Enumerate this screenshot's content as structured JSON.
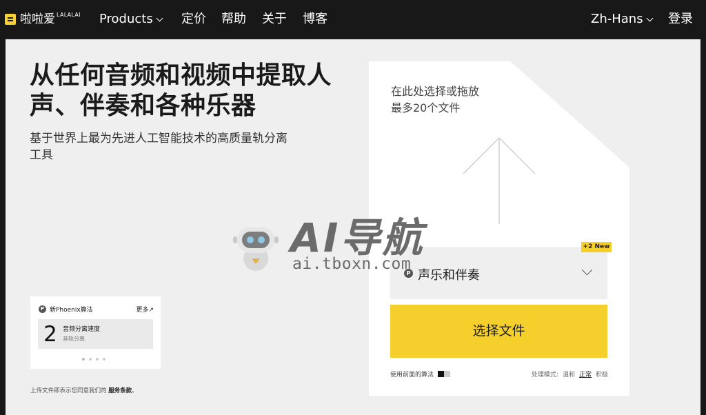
{
  "nav": {
    "logo_text": "啦啦爱",
    "logo_sup": "LALALAI",
    "items": [
      {
        "label": "Products"
      },
      {
        "label": "定价"
      },
      {
        "label": "帮助"
      },
      {
        "label": "关于"
      },
      {
        "label": "博客"
      }
    ],
    "language": "Zh-Hans",
    "login": "登录"
  },
  "hero": {
    "headline": "从任何音频和视频中提取人声、伴奏和各种乐器",
    "subtitle": "基于世界上最为先进人工智能技术的高质量轨分离工具"
  },
  "mini_card": {
    "icon": "P",
    "title": "新Phoenix算法",
    "more": "更多↗",
    "number": "2",
    "label": "音频分离速度",
    "sublabel": "音轨分离"
  },
  "terms": {
    "prefix": "上传文件即表示您同意我们的",
    "link": "服务条款",
    "suffix": "。"
  },
  "upload": {
    "line1": "在此处选择或拖放",
    "line2": "最多20个文件",
    "badge": "+2 New",
    "select_icon": "P",
    "select_value": "声乐和伴奏",
    "choose_button": "选择文件",
    "prev_algo": "使用前面的算法",
    "mode_label": "处理模式:",
    "modes": [
      "温和",
      "正常",
      "积极"
    ]
  },
  "watermark": {
    "title": "AI导航",
    "url": "ai.tboxn.com"
  },
  "colors": {
    "accent": "#f5cf2b",
    "nav_bg": "#181818",
    "page_bg": "#efefef"
  }
}
